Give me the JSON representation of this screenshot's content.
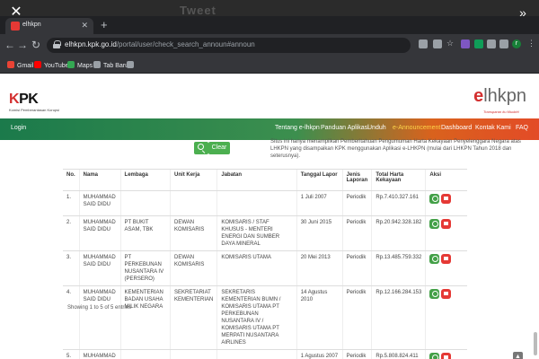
{
  "overlay": {
    "close_glyph": "✕",
    "forward_glyph": "»",
    "faint_title": "Tweet"
  },
  "browser": {
    "tab_title": "elhkpn",
    "newtab": "+",
    "url_host": "elhkpn.kpk.go.id",
    "url_path": "/portal/user/check_search_announ#announ",
    "bookmarks": [
      {
        "label": "Gmail",
        "icon_color": "#ea4335"
      },
      {
        "label": "YouTube",
        "icon_color": "#ff0000"
      },
      {
        "label": "Maps",
        "icon_color": "#34a853"
      },
      {
        "label": "Tab Baru",
        "icon_color": "#9aa0a6"
      }
    ],
    "avatar_initial": "r"
  },
  "site": {
    "logo": "KPK",
    "logo_sub": "Komisi Pemberantasan Korupsi",
    "brand_e": "e",
    "brand_rest": "lhkpn",
    "brand_sub": "Transparan itu Mudah!",
    "nav_login": "Login",
    "nav_items": [
      "Tentang e-lhkpn",
      "Panduan Aplikasi",
      "Unduh",
      "e-Announcement",
      "Dashboard",
      "Kontak Kami",
      "FAQ"
    ],
    "active_nav": "e-Announcement",
    "clear_label": "Clear",
    "notice": "Situs ini hanya menampilkan Pemberitahuan Pengumuman Harta Kekayaan Penyelenggara Negara atas LHKPN yang disampaikan KPK menggunakan Aplikasi e-LHKPN (mulai dari LHKPN Tahun 2018 dan seterusnya).",
    "colors": {
      "green": "#1b7a4b",
      "orange": "#e34b27",
      "button_green": "#4caf50",
      "action_red": "#e53935"
    }
  },
  "table": {
    "headers": [
      "No.",
      "Nama",
      "Lembaga",
      "Unit Kerja",
      "Jabatan",
      "Tanggal Lapor",
      "Jenis Laporan",
      "Total Harta Kekayaan",
      "Aksi"
    ],
    "rows": [
      [
        "1.",
        "MUHAMMAD SAID DIDU",
        "",
        "",
        "",
        "1 Juli 2007",
        "Periodik",
        "Rp.7.410.327.161"
      ],
      [
        "2.",
        "MUHAMMAD SAID DIDU",
        "PT BUKIT ASAM, TBK",
        "DEWAN KOMISARIS",
        "KOMISARIS / STAF KHUSUS - MENTERI ENERGI DAN SUMBER DAYA MINERAL",
        "30 Juni 2015",
        "Periodik",
        "Rp.20.942.328.182"
      ],
      [
        "3.",
        "MUHAMMAD SAID DIDU",
        "PT PERKEBUNAN NUSANTARA IV (PERSERO)",
        "DEWAN KOMISARIS",
        "KOMISARIS UTAMA",
        "20 Mei 2013",
        "Periodik",
        "Rp.13.485.759.332"
      ],
      [
        "4.",
        "MUHAMMAD SAID DIDU",
        "KEMENTERIAN BADAN USAHA MILIK NEGARA",
        "SEKRETARIAT KEMENTERIAN",
        "SEKRETARIS KEMENTERIAN BUMN / KOMISARIS UTAMA PT PERKEBUNAN NUSANTARA IV / KOMISARIS UTAMA PT MERPATI NUSANTARA AIRLINES",
        "14 Agustus 2010",
        "Periodik",
        "Rp.12.166.284.153"
      ],
      [
        "5.",
        "MUHAMMAD SAID DIDU",
        "",
        "",
        "",
        "1 Agustus 2007",
        "Periodik",
        "Rp.5.808.824.411"
      ]
    ],
    "showing": "Showing 1 to 5 of 5 entries"
  }
}
